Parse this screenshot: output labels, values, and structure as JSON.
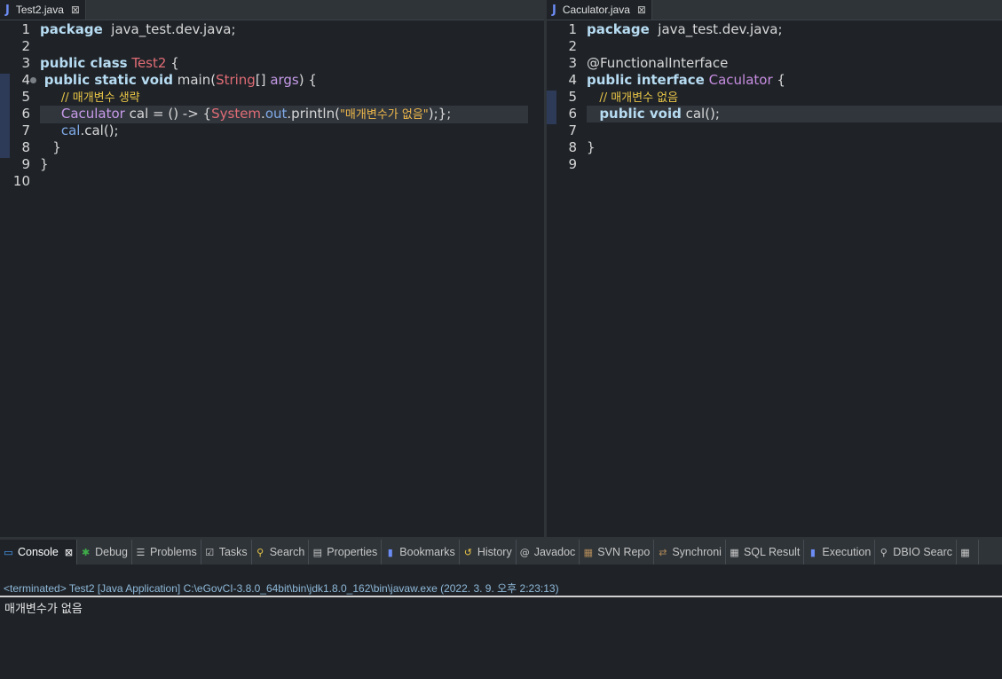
{
  "editors": {
    "left": {
      "tab": {
        "icon": "J",
        "title": "Test2.java",
        "close": "⊠"
      },
      "lines": [
        {
          "n": "1",
          "seg": [
            [
              "kw",
              "package"
            ],
            [
              "",
              "  java_test.dev.java;"
            ]
          ]
        },
        {
          "n": "2",
          "seg": []
        },
        {
          "n": "3",
          "seg": [
            [
              "kw",
              "public class"
            ],
            [
              "",
              " "
            ],
            [
              "cls",
              "Test2"
            ],
            [
              "",
              " {"
            ]
          ]
        },
        {
          "n": "4",
          "seg": [
            [
              "",
              " "
            ],
            [
              "kw",
              "public static void"
            ],
            [
              "",
              " main("
            ],
            [
              "cls",
              "String"
            ],
            [
              "",
              "[] "
            ],
            [
              "param",
              "args"
            ],
            [
              "",
              ") {"
            ]
          ]
        },
        {
          "n": "5",
          "seg": [
            [
              "",
              "     "
            ],
            [
              "cmt",
              "// 매개변수 생략"
            ]
          ]
        },
        {
          "n": "6",
          "seg": [
            [
              "",
              "     "
            ],
            [
              "param",
              "Caculator"
            ],
            [
              "",
              " cal = () -> {"
            ],
            [
              "sys",
              "System"
            ],
            [
              "",
              "."
            ],
            [
              "fld",
              "out"
            ],
            [
              "",
              ".println("
            ],
            [
              "str",
              "\"매개변수가 없음\""
            ],
            [
              "",
              ");};"
            ]
          ]
        },
        {
          "n": "7",
          "seg": [
            [
              "",
              "     "
            ],
            [
              "fld",
              "cal"
            ],
            [
              "",
              ".cal();"
            ]
          ]
        },
        {
          "n": "8",
          "seg": [
            [
              "",
              "   }"
            ]
          ]
        },
        {
          "n": "9",
          "seg": [
            [
              "",
              "}"
            ]
          ]
        },
        {
          "n": "10",
          "seg": []
        }
      ]
    },
    "right": {
      "tab": {
        "icon": "J",
        "title": "Caculator.java",
        "close": "⊠"
      },
      "lines": [
        {
          "n": "1",
          "seg": [
            [
              "kw",
              "package"
            ],
            [
              "",
              "  java_test.dev.java;"
            ]
          ]
        },
        {
          "n": "2",
          "seg": []
        },
        {
          "n": "3",
          "seg": [
            [
              "ann",
              "@FunctionalInterface"
            ]
          ]
        },
        {
          "n": "4",
          "seg": [
            [
              "kw",
              "public interface"
            ],
            [
              "",
              " "
            ],
            [
              "iface",
              "Caculator"
            ],
            [
              "",
              " {"
            ]
          ]
        },
        {
          "n": "5",
          "seg": [
            [
              "",
              "   "
            ],
            [
              "cmt",
              "// 매개변수 없음"
            ]
          ]
        },
        {
          "n": "6",
          "seg": [
            [
              "",
              "   "
            ],
            [
              "kw",
              "public void"
            ],
            [
              "",
              " cal();"
            ]
          ]
        },
        {
          "n": "7",
          "seg": []
        },
        {
          "n": "8",
          "seg": [
            [
              "",
              "}"
            ]
          ]
        },
        {
          "n": "9",
          "seg": []
        }
      ]
    }
  },
  "bottom": {
    "tabs": [
      {
        "label": "Console",
        "icon": "monitor-icon",
        "glyph": "▭",
        "color": "#4aa3ff",
        "close": "⊠",
        "active": true
      },
      {
        "label": "Debug",
        "icon": "bug-icon",
        "glyph": "✱",
        "color": "#3fae4a"
      },
      {
        "label": "Problems",
        "icon": "problems-icon",
        "glyph": "☰",
        "color": "#c6c6c6"
      },
      {
        "label": "Tasks",
        "icon": "tasks-icon",
        "glyph": "☑",
        "color": "#c6c6c6"
      },
      {
        "label": "Search",
        "icon": "search-icon",
        "glyph": "⚲",
        "color": "#e8c547"
      },
      {
        "label": "Properties",
        "icon": "properties-icon",
        "glyph": "▤",
        "color": "#c6c6c6"
      },
      {
        "label": "Bookmarks",
        "icon": "bookmark-icon",
        "glyph": "▮",
        "color": "#6c8cf5"
      },
      {
        "label": "History",
        "icon": "history-icon",
        "glyph": "↺",
        "color": "#e8c547"
      },
      {
        "label": "Javadoc",
        "icon": "at-icon",
        "glyph": "@",
        "color": "#c6c6c6"
      },
      {
        "label": "SVN Repo",
        "icon": "repo-icon",
        "glyph": "▦",
        "color": "#b08a5a"
      },
      {
        "label": "Synchroni",
        "icon": "sync-icon",
        "glyph": "⇄",
        "color": "#b08a5a"
      },
      {
        "label": "SQL Result",
        "icon": "table-icon",
        "glyph": "▦",
        "color": "#c6c6c6"
      },
      {
        "label": "Execution",
        "icon": "execution-icon",
        "glyph": "▮",
        "color": "#6c8cf5"
      },
      {
        "label": "DBIO Searc",
        "icon": "pin-icon",
        "glyph": "⚲",
        "color": "#c6c6c6"
      },
      {
        "label": "",
        "icon": "table-icon",
        "glyph": "▦",
        "color": "#c6c6c6"
      }
    ],
    "status": "<terminated> Test2 [Java Application] C:\\eGovCI-3.8.0_64bit\\bin\\jdk1.8.0_162\\bin\\javaw.exe (2022. 3. 9. 오후 2:23:13)",
    "output": "매개변수가 없음"
  },
  "colors": {
    "editor_bg": "#1f2328",
    "chrome": "#2f3438",
    "keyword": "#b7dcf2",
    "comment": "#e8c547",
    "class": "#e06c75"
  }
}
